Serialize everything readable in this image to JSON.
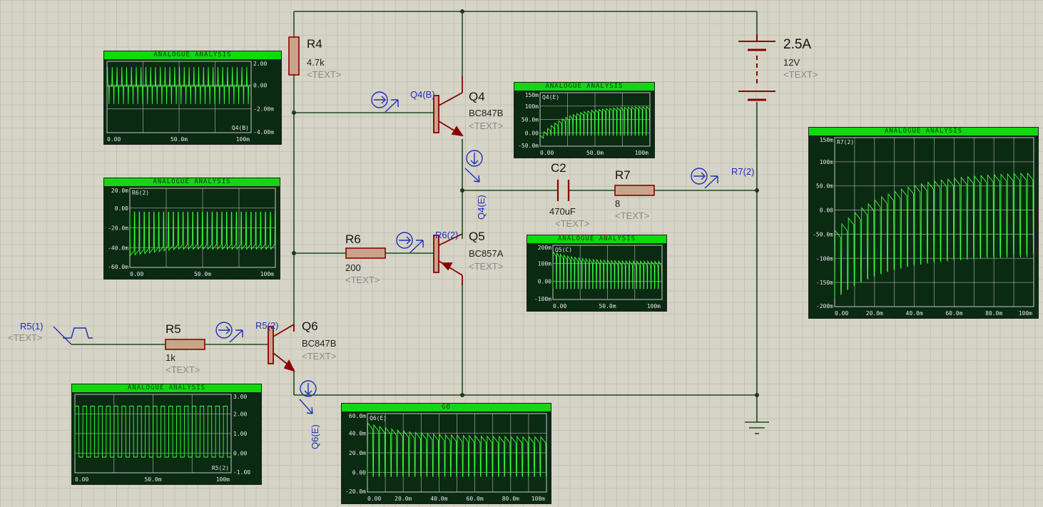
{
  "components": {
    "r4": {
      "name": "R4",
      "value": "4.7k",
      "text": "<TEXT>"
    },
    "r5": {
      "name": "R5",
      "value": "1k",
      "text": "<TEXT>"
    },
    "r6": {
      "name": "R6",
      "value": "200",
      "text": "<TEXT>"
    },
    "r7": {
      "name": "R7",
      "value": "8",
      "text": "<TEXT>"
    },
    "c2": {
      "name": "C2",
      "value": "470uF",
      "text": "<TEXT>"
    },
    "q4": {
      "name": "Q4",
      "value": "BC847B",
      "text": "<TEXT>"
    },
    "q5": {
      "name": "Q5",
      "value": "BC857A",
      "text": "<TEXT>"
    },
    "q6": {
      "name": "Q6",
      "value": "BC847B",
      "text": "<TEXT>"
    },
    "battery": {
      "name": "2.5A",
      "value": "12V",
      "text": "<TEXT>"
    },
    "source": {
      "name": "R5(1)",
      "text": "<TEXT>"
    }
  },
  "probes": {
    "q4b": "Q4(B)",
    "q4e": "Q4(E)",
    "r6_2": "R6(2)",
    "r5_2": "R5(2)",
    "q6e": "Q6(E)",
    "r7_2": "R7(2)"
  },
  "graphs": [
    {
      "id": "q4b",
      "title": "ANALOGUE ANALYSIS",
      "trace": "Q4(B)",
      "trace_pos": "bottom-right",
      "yticks": [
        "2.00",
        "0.00",
        "-2.00m",
        "-4.00m"
      ],
      "xticks": [
        "0.00",
        "50.0m",
        "100m"
      ],
      "waveform": "spike"
    },
    {
      "id": "r6",
      "title": "ANALOGUE ANALYSIS",
      "trace": "R6(2)",
      "trace_pos": "top-left",
      "yticks": [
        "20.0m",
        "0.00",
        "-20.0m",
        "-40.0m",
        "-60.0m"
      ],
      "xticks": [
        "0.00",
        "50.0m",
        "100m"
      ],
      "waveform": "neg-pulse"
    },
    {
      "id": "q4e",
      "title": "ANALOGUE ANALYSIS",
      "trace": "Q4(E)",
      "trace_pos": "top-left",
      "yticks": [
        "150m",
        "100m",
        "50.0m",
        "0.00",
        "-50.0m"
      ],
      "xticks": [
        "0.00",
        "50.0m",
        "100m"
      ],
      "waveform": "rise-pulse"
    },
    {
      "id": "q5c",
      "title": "ANALOGUE ANALYSIS",
      "trace": "Q5(C)",
      "trace_pos": "top-left",
      "yticks": [
        "200m",
        "100m",
        "0.00",
        "-100m"
      ],
      "xticks": [
        "0.00",
        "50.0m",
        "100m"
      ],
      "waveform": "decay-pulse"
    },
    {
      "id": "r7",
      "title": "ANALOGUE ANALYSIS",
      "trace": "R7(2)",
      "trace_pos": "top-left",
      "yticks": [
        "150m",
        "100m",
        "50.0m",
        "0.00",
        "-50.0m",
        "-100m",
        "-150m",
        "-200m"
      ],
      "xticks": [
        "0.00",
        "20.0m",
        "40.0m",
        "60.0m",
        "80.0m",
        "100m"
      ],
      "waveform": "ac-rise"
    },
    {
      "id": "r5",
      "title": "ANALOGUE ANALYSIS",
      "trace": "R5(2)",
      "trace_pos": "bottom-right",
      "yticks": [
        "3.00",
        "2.00",
        "1.00",
        "0.00",
        "-1.00"
      ],
      "xticks": [
        "0.00",
        "50.0m",
        "100m"
      ],
      "waveform": "square"
    },
    {
      "id": "q6e",
      "title": "GO",
      "trace": "Q6(E)",
      "trace_pos": "top-left",
      "yticks": [
        "60.0m",
        "40.0m",
        "20.0m",
        "0.00",
        "-20.0m"
      ],
      "xticks": [
        "0.00",
        "20.0m",
        "40.0m",
        "60.0m",
        "80.0m",
        "100m"
      ],
      "waveform": "decay-pulse"
    }
  ],
  "colors": {
    "wire": "#1f4a1f",
    "component": "#8b0000",
    "resistor_fill": "#c9a48a",
    "probe": "#1f2fb8",
    "graph_bg": "#0a2a12",
    "graph_title": "#12d812",
    "trace": "#3cff3c",
    "graph_grid": "#c8c8c8",
    "graph_ticks": "#e8e8e8"
  }
}
